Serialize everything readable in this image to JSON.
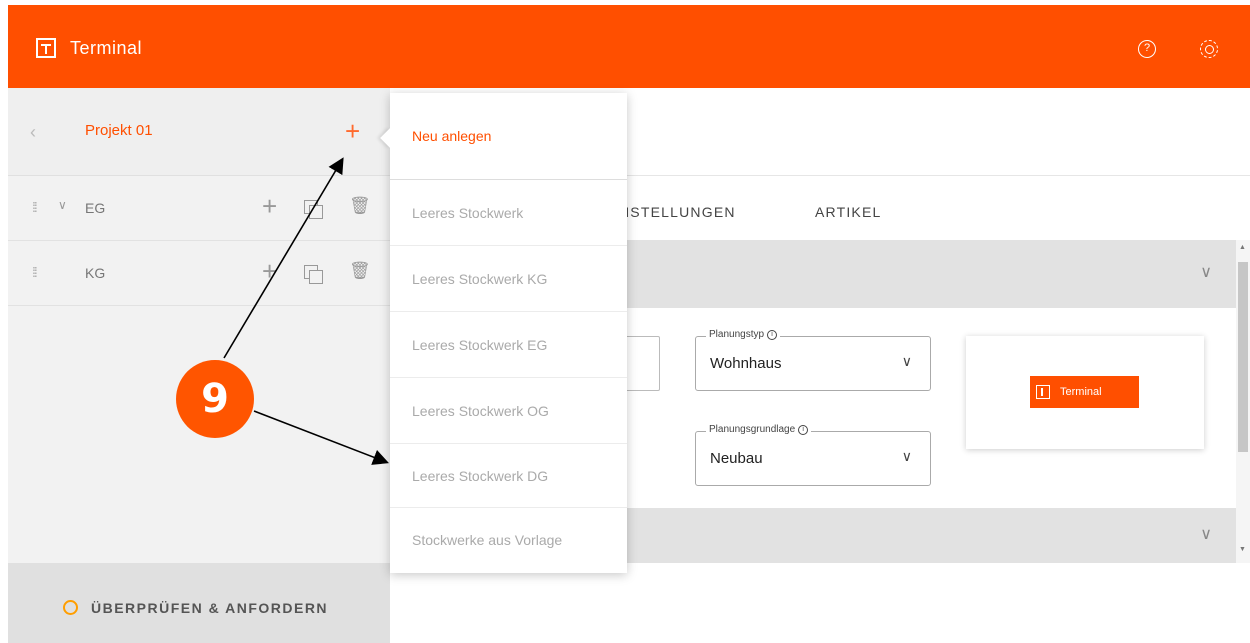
{
  "app": {
    "title": "Terminal"
  },
  "header": {
    "help_icon": "help-icon",
    "settings_icon": "gear-icon"
  },
  "sidebar": {
    "project_name": "Projekt 01",
    "floors": [
      {
        "label": "EG"
      },
      {
        "label": "KG"
      }
    ],
    "review_label": "ÜBERPRÜFEN & ANFORDERN"
  },
  "tabs": [
    {
      "label": "NSTELLUNGEN"
    },
    {
      "label": "ARTIKEL"
    }
  ],
  "form": {
    "planning_type": {
      "legend": "Planungstyp",
      "value": "Wohnhaus"
    },
    "planning_basis": {
      "legend": "Planungsgrundlage",
      "value": "Neubau"
    }
  },
  "preview": {
    "logo_text": "Terminal"
  },
  "menu": {
    "items": [
      {
        "label": "Neu anlegen"
      },
      {
        "label": "Leeres Stockwerk"
      },
      {
        "label": "Leeres Stockwerk KG"
      },
      {
        "label": "Leeres Stockwerk EG"
      },
      {
        "label": "Leeres Stockwerk OG"
      },
      {
        "label": "Leeres Stockwerk DG"
      },
      {
        "label": "Stockwerke aus Vorlage"
      }
    ]
  },
  "annotation": {
    "number": "9",
    "color": "#ff5500"
  },
  "colors": {
    "brand": "#ff4f00",
    "review_status": "#ff9e00"
  }
}
